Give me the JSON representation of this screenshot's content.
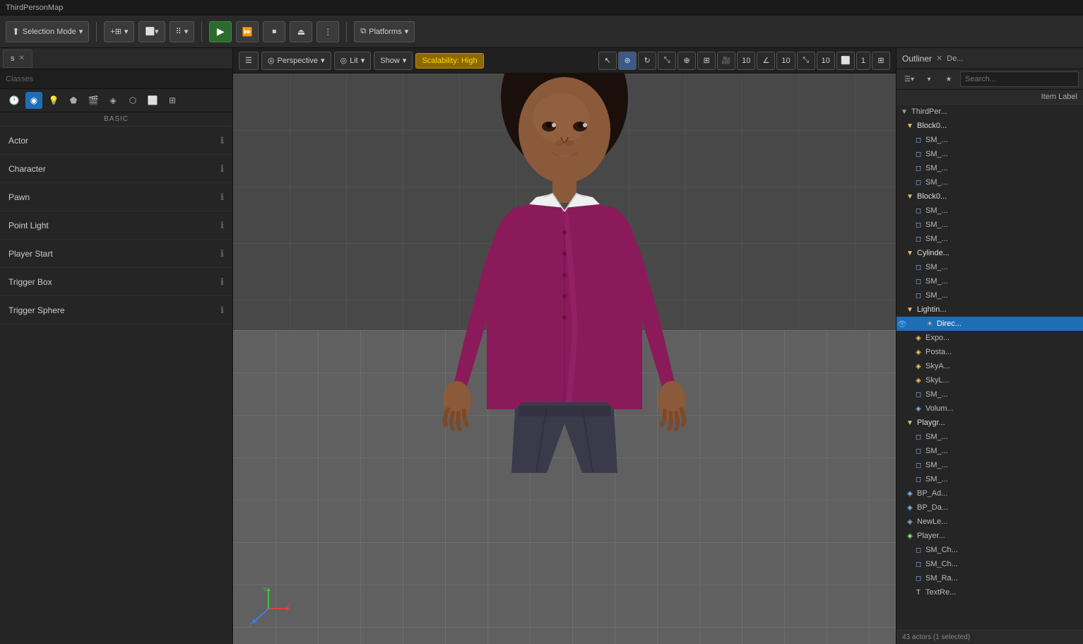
{
  "titleBar": {
    "text": "ThirdPersonMap"
  },
  "toolbar": {
    "selectionMode": "Selection Mode",
    "platforms": "Platforms",
    "playBtn": "▶",
    "playFromHereBtn": "⏩",
    "stopBtn": "⏹",
    "ejectBtn": "⏏",
    "moreBtn": "⋮"
  },
  "leftPanel": {
    "tabLabel": "s",
    "searchPlaceholder": "Classes",
    "categoryLabel": "BASIC",
    "items": [
      {
        "name": "Actor",
        "index": 0
      },
      {
        "name": "Character",
        "index": 1
      },
      {
        "name": "Pawn",
        "index": 2
      },
      {
        "name": "Point Light",
        "index": 3
      },
      {
        "name": "Player Start",
        "index": 4
      },
      {
        "name": "Trigger Box",
        "index": 5
      },
      {
        "name": "Trigger Sphere",
        "index": 6
      }
    ]
  },
  "viewport": {
    "hamburger": "☰",
    "perspective": "Perspective",
    "lit": "Lit",
    "show": "Show",
    "scalability": "Scalability: High",
    "gridNum1": "10",
    "gridNum2": "10",
    "gridNum3": "10",
    "gridNum4": "1"
  },
  "outliner": {
    "title": "Outliner",
    "detailsLabel": "De...",
    "searchPlaceholder": "Search...",
    "columnLabel": "Item Label",
    "treeItems": [
      {
        "level": 0,
        "label": "ThirdPer...",
        "type": "root",
        "icon": "▼"
      },
      {
        "level": 1,
        "label": "Block0...",
        "type": "folder",
        "icon": "▼"
      },
      {
        "level": 2,
        "label": "SM_...",
        "type": "mesh",
        "icon": "◻"
      },
      {
        "level": 2,
        "label": "SM_...",
        "type": "mesh",
        "icon": "◻"
      },
      {
        "level": 2,
        "label": "SM_...",
        "type": "mesh",
        "icon": "◻"
      },
      {
        "level": 2,
        "label": "SM_...",
        "type": "mesh",
        "icon": "◻"
      },
      {
        "level": 1,
        "label": "Block0...",
        "type": "folder",
        "icon": "▼"
      },
      {
        "level": 2,
        "label": "SM_...",
        "type": "mesh",
        "icon": "◻"
      },
      {
        "level": 2,
        "label": "SM_...",
        "type": "mesh",
        "icon": "◻"
      },
      {
        "level": 2,
        "label": "SM_...",
        "type": "mesh",
        "icon": "◻"
      },
      {
        "level": 1,
        "label": "Cylinde...",
        "type": "folder",
        "icon": "▼"
      },
      {
        "level": 2,
        "label": "SM_...",
        "type": "mesh",
        "icon": "◻"
      },
      {
        "level": 2,
        "label": "SM_...",
        "type": "mesh",
        "icon": "◻"
      },
      {
        "level": 2,
        "label": "SM_...",
        "type": "mesh",
        "icon": "◻"
      },
      {
        "level": 1,
        "label": "Lightin...",
        "type": "folder",
        "icon": "▼"
      },
      {
        "level": 2,
        "label": "Direc...",
        "type": "light",
        "icon": "☀",
        "selected": true
      },
      {
        "level": 2,
        "label": "Expo...",
        "type": "light",
        "icon": "◈"
      },
      {
        "level": 2,
        "label": "Posta...",
        "type": "light",
        "icon": "◈"
      },
      {
        "level": 2,
        "label": "SkyA...",
        "type": "light",
        "icon": "◈"
      },
      {
        "level": 2,
        "label": "SkyL...",
        "type": "light",
        "icon": "◈"
      },
      {
        "level": 2,
        "label": "SM_...",
        "type": "mesh",
        "icon": "◻"
      },
      {
        "level": 2,
        "label": "Volum...",
        "type": "volume",
        "icon": "◈"
      },
      {
        "level": 1,
        "label": "Playgr...",
        "type": "folder",
        "icon": "▼"
      },
      {
        "level": 2,
        "label": "SM_...",
        "type": "mesh",
        "icon": "◻"
      },
      {
        "level": 2,
        "label": "SM_...",
        "type": "mesh",
        "icon": "◻"
      },
      {
        "level": 2,
        "label": "SM_...",
        "type": "mesh",
        "icon": "◻"
      },
      {
        "level": 2,
        "label": "SM_...",
        "type": "mesh",
        "icon": "◻"
      },
      {
        "level": 1,
        "label": "BP_Ad...",
        "type": "bp",
        "icon": "◈"
      },
      {
        "level": 1,
        "label": "BP_Da...",
        "type": "bp",
        "icon": "◈"
      },
      {
        "level": 1,
        "label": "NewLe...",
        "type": "misc",
        "icon": "◈"
      },
      {
        "level": 1,
        "label": "Player...",
        "type": "player",
        "icon": "◈"
      },
      {
        "level": 2,
        "label": "SM_Ch...",
        "type": "mesh",
        "icon": "◻"
      },
      {
        "level": 2,
        "label": "SM_Ch...",
        "type": "mesh",
        "icon": "◻"
      },
      {
        "level": 2,
        "label": "SM_Ra...",
        "type": "mesh",
        "icon": "◻"
      },
      {
        "level": 2,
        "label": "TextRe...",
        "type": "text",
        "icon": "T"
      }
    ],
    "footerText": "43 actors (1 selected)"
  },
  "colors": {
    "accent": "#1e6eb5",
    "selected": "#1e6eb5",
    "scalabilityHigh": "#ffd700",
    "playGreen": "#2d6a2d",
    "folderColor": "#e8c070",
    "meshColor": "#8ab4e8"
  }
}
